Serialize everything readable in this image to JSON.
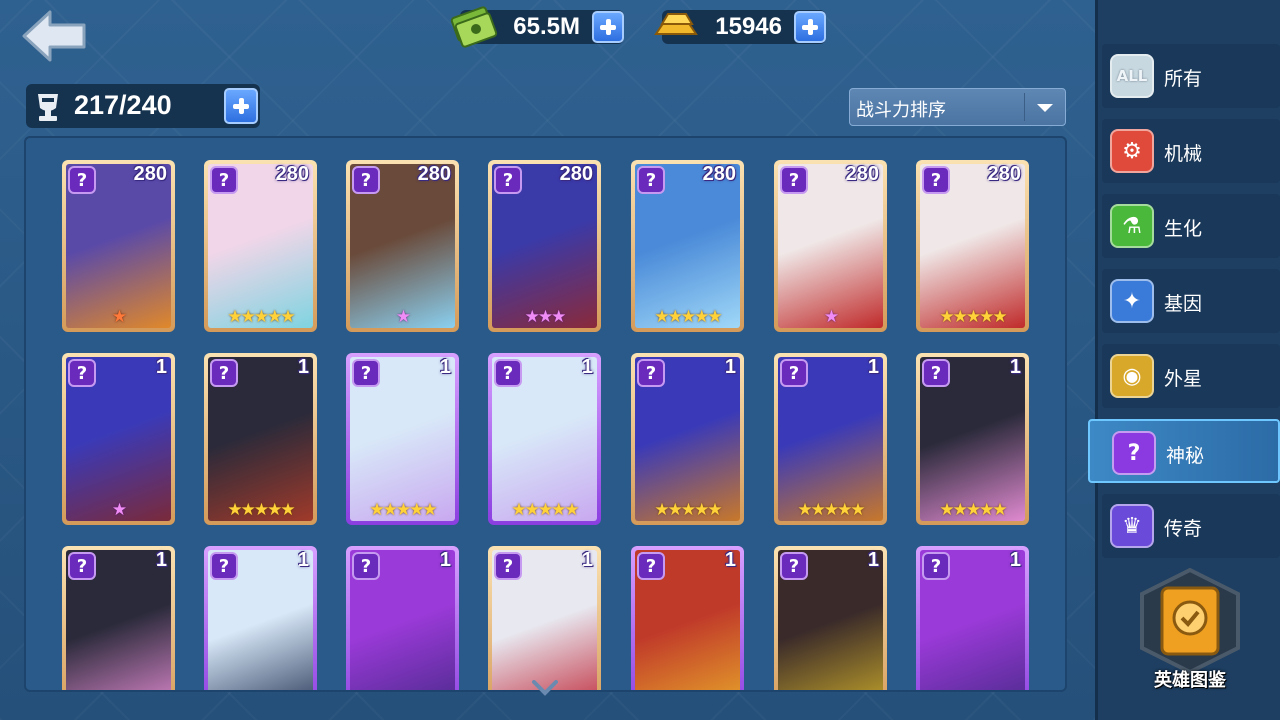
{
  "currencies": [
    {
      "name": "cash",
      "value": "65.5M",
      "icon": "cash-icon"
    },
    {
      "name": "gold",
      "value": "15946",
      "icon": "gold-bar-icon"
    }
  ],
  "capacity": {
    "text": "217/240",
    "icon": "trophy-icon"
  },
  "sort": {
    "label": "战斗力排序"
  },
  "cards": [
    {
      "level": "280",
      "stars": "★",
      "star_style": "orange",
      "frame": "gold",
      "colors": [
        "#5a4aa8",
        "#e0882a"
      ]
    },
    {
      "level": "280",
      "stars": "★★★★★",
      "star_style": "gold",
      "frame": "gold",
      "colors": [
        "#f0d6e8",
        "#7fd3e0"
      ]
    },
    {
      "level": "280",
      "stars": "★",
      "star_style": "pink",
      "frame": "gold",
      "colors": [
        "#6a4a3a",
        "#8ad0f0"
      ]
    },
    {
      "level": "280",
      "stars": "★★★",
      "star_style": "pink",
      "frame": "gold",
      "colors": [
        "#3a3aa8",
        "#8a2a3a"
      ]
    },
    {
      "level": "280",
      "stars": "★★★★★",
      "star_style": "gold",
      "frame": "gold",
      "colors": [
        "#4a8ad8",
        "#a0d8f8"
      ]
    },
    {
      "level": "280",
      "stars": "★",
      "star_style": "pink",
      "frame": "gold",
      "colors": [
        "#f0e8e8",
        "#c02a2a"
      ]
    },
    {
      "level": "280",
      "stars": "★★★★★",
      "star_style": "gold",
      "frame": "gold",
      "colors": [
        "#f0e8e8",
        "#c02a2a"
      ]
    },
    {
      "level": "1",
      "stars": "★",
      "star_style": "pink",
      "frame": "gold",
      "colors": [
        "#3a3ab8",
        "#7a2a3a"
      ]
    },
    {
      "level": "1",
      "stars": "★★★★★",
      "star_style": "gold",
      "frame": "gold",
      "colors": [
        "#2a2a3a",
        "#a03a2a"
      ]
    },
    {
      "level": "1",
      "stars": "★★★★★",
      "star_style": "gold",
      "frame": "purple",
      "colors": [
        "#d8e8f8",
        "#c8a8f0"
      ]
    },
    {
      "level": "1",
      "stars": "★★★★★",
      "star_style": "gold",
      "frame": "purple",
      "colors": [
        "#d8e8f8",
        "#c8a8f0"
      ]
    },
    {
      "level": "1",
      "stars": "★★★★★",
      "star_style": "gold",
      "frame": "gold",
      "colors": [
        "#3a3ab8",
        "#c8782a"
      ]
    },
    {
      "level": "1",
      "stars": "★★★★★",
      "star_style": "gold",
      "frame": "gold",
      "colors": [
        "#3a3ab8",
        "#c8782a"
      ]
    },
    {
      "level": "1",
      "stars": "★★★★★",
      "star_style": "gold",
      "frame": "gold",
      "colors": [
        "#2a2a3a",
        "#e08ad0"
      ]
    },
    {
      "level": "1",
      "stars": "",
      "star_style": "gold",
      "frame": "gold",
      "colors": [
        "#2a2a3a",
        "#e08ad0"
      ]
    },
    {
      "level": "1",
      "stars": "",
      "star_style": "gold",
      "frame": "purple",
      "colors": [
        "#d8e8f8",
        "#2a3a5a"
      ]
    },
    {
      "level": "1",
      "stars": "",
      "star_style": "gold",
      "frame": "purple",
      "colors": [
        "#9a3ad8",
        "#4a2a8a"
      ]
    },
    {
      "level": "1",
      "stars": "",
      "star_style": "gold",
      "frame": "gold",
      "colors": [
        "#e8e8f0",
        "#c02a3a"
      ]
    },
    {
      "level": "1",
      "stars": "",
      "star_style": "gold",
      "frame": "purple",
      "colors": [
        "#c03a2a",
        "#e8a82a"
      ]
    },
    {
      "level": "1",
      "stars": "",
      "star_style": "gold",
      "frame": "gold",
      "colors": [
        "#3a2a2a",
        "#c8a82a"
      ]
    },
    {
      "level": "1",
      "stars": "",
      "star_style": "gold",
      "frame": "purple",
      "colors": [
        "#9a3ad8",
        "#4a2a8a"
      ]
    }
  ],
  "sidebar": {
    "items": [
      {
        "label": "所有",
        "icon": "all-icon",
        "glyph": "ALL",
        "color": "#c8d8e0"
      },
      {
        "label": "机械",
        "icon": "mechanical-icon",
        "glyph": "⚙",
        "color": "#e04a3a"
      },
      {
        "label": "生化",
        "icon": "flask-icon",
        "glyph": "⚗",
        "color": "#4ab83a"
      },
      {
        "label": "基因",
        "icon": "dna-icon",
        "glyph": "✦",
        "color": "#3a7ad8"
      },
      {
        "label": "外星",
        "icon": "alien-icon",
        "glyph": "◉",
        "color": "#d8a82a"
      },
      {
        "label": "神秘",
        "icon": "mystery-icon",
        "glyph": "?",
        "color": "#8a3ae0"
      },
      {
        "label": "传奇",
        "icon": "legend-icon",
        "glyph": "♛",
        "color": "#6a4ad8"
      }
    ],
    "active_index": 5
  },
  "codex": {
    "label": "英雄图鉴",
    "icon": "codex-book-icon"
  }
}
